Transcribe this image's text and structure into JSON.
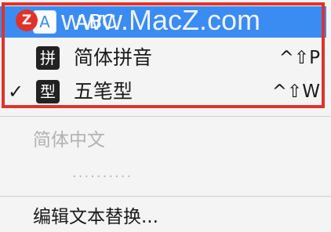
{
  "menu": {
    "items": [
      {
        "badge": "A",
        "label": "ABC",
        "shortcut": "",
        "checked": false,
        "highlighted": true
      },
      {
        "badge": "拼",
        "label": "简体拼音",
        "shortcut": "^⇧P",
        "checked": false,
        "highlighted": false
      },
      {
        "badge": "型",
        "label": "五笔型",
        "shortcut": "^⇧W",
        "checked": true,
        "highlighted": false
      }
    ],
    "check_mark": "✓",
    "disabled_header": "简体中文",
    "disabled_dots": "..........",
    "edit_item": "编辑文本替换..."
  },
  "watermark": {
    "logo_letter": "Z",
    "text": "www.MacZ.com"
  },
  "colors": {
    "highlight": "#3b8cf2",
    "annotation_box": "#e0322b",
    "menu_bg": "#f4f4f4"
  }
}
